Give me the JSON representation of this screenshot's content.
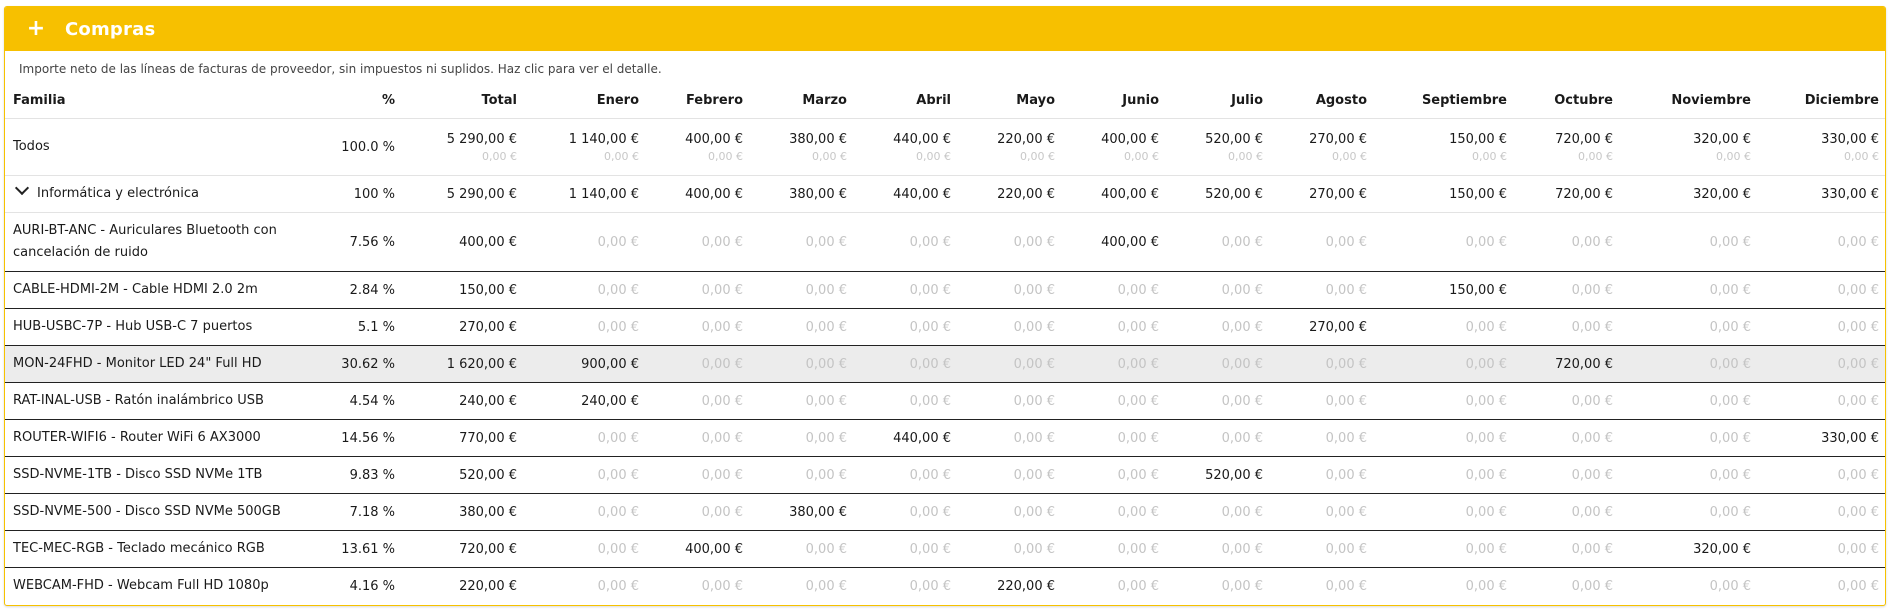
{
  "panel": {
    "title": "Compras",
    "expand_icon": "+",
    "description": "Importe neto de las líneas de facturas de proveedor, sin impuestos ni suplidos. Haz clic para ver el detalle.",
    "accent_color": "#f7c000"
  },
  "columns": {
    "familia": "Familia",
    "pct": "%",
    "total": "Total",
    "months": [
      "Enero",
      "Febrero",
      "Marzo",
      "Abril",
      "Mayo",
      "Junio",
      "Julio",
      "Agosto",
      "Septiembre",
      "Octubre",
      "Noviembre",
      "Diciembre"
    ]
  },
  "total_row": {
    "label": "Todos",
    "pct": "100.0 %",
    "total": "5 290,00 €",
    "total_sub": "0,00 €",
    "months": [
      "1 140,00 €",
      "400,00 €",
      "380,00 €",
      "440,00 €",
      "220,00 €",
      "400,00 €",
      "520,00 €",
      "270,00 €",
      "150,00 €",
      "720,00 €",
      "320,00 €",
      "330,00 €"
    ],
    "months_sub": [
      "0,00 €",
      "0,00 €",
      "0,00 €",
      "0,00 €",
      "0,00 €",
      "0,00 €",
      "0,00 €",
      "0,00 €",
      "0,00 €",
      "0,00 €",
      "0,00 €",
      "0,00 €"
    ]
  },
  "group_row": {
    "label": "Informática y electrónica",
    "icon": "chevron-down-icon",
    "pct": "100 %",
    "total": "5 290,00 €",
    "months": [
      "1 140,00 €",
      "400,00 €",
      "380,00 €",
      "440,00 €",
      "220,00 €",
      "400,00 €",
      "520,00 €",
      "270,00 €",
      "150,00 €",
      "720,00 €",
      "320,00 €",
      "330,00 €"
    ]
  },
  "items": [
    {
      "label": "AURI-BT-ANC - Auriculares Bluetooth con cancelación de ruido",
      "pct": "7.56 %",
      "total": "400,00 €",
      "months": [
        "0,00 €",
        "0,00 €",
        "0,00 €",
        "0,00 €",
        "0,00 €",
        "400,00 €",
        "0,00 €",
        "0,00 €",
        "0,00 €",
        "0,00 €",
        "0,00 €",
        "0,00 €"
      ]
    },
    {
      "label": "CABLE-HDMI-2M - Cable HDMI 2.0 2m",
      "pct": "2.84 %",
      "total": "150,00 €",
      "months": [
        "0,00 €",
        "0,00 €",
        "0,00 €",
        "0,00 €",
        "0,00 €",
        "0,00 €",
        "0,00 €",
        "0,00 €",
        "150,00 €",
        "0,00 €",
        "0,00 €",
        "0,00 €"
      ]
    },
    {
      "label": "HUB-USBC-7P - Hub USB-C 7 puertos",
      "pct": "5.1 %",
      "total": "270,00 €",
      "months": [
        "0,00 €",
        "0,00 €",
        "0,00 €",
        "0,00 €",
        "0,00 €",
        "0,00 €",
        "0,00 €",
        "270,00 €",
        "0,00 €",
        "0,00 €",
        "0,00 €",
        "0,00 €"
      ]
    },
    {
      "label": "MON-24FHD - Monitor LED 24\" Full HD",
      "pct": "30.62 %",
      "total": "1 620,00 €",
      "months": [
        "900,00 €",
        "0,00 €",
        "0,00 €",
        "0,00 €",
        "0,00 €",
        "0,00 €",
        "0,00 €",
        "0,00 €",
        "0,00 €",
        "720,00 €",
        "0,00 €",
        "0,00 €"
      ]
    },
    {
      "label": "RAT-INAL-USB - Ratón inalámbrico USB",
      "pct": "4.54 %",
      "total": "240,00 €",
      "months": [
        "240,00 €",
        "0,00 €",
        "0,00 €",
        "0,00 €",
        "0,00 €",
        "0,00 €",
        "0,00 €",
        "0,00 €",
        "0,00 €",
        "0,00 €",
        "0,00 €",
        "0,00 €"
      ]
    },
    {
      "label": "ROUTER-WIFI6 - Router WiFi 6 AX3000",
      "pct": "14.56 %",
      "total": "770,00 €",
      "months": [
        "0,00 €",
        "0,00 €",
        "0,00 €",
        "440,00 €",
        "0,00 €",
        "0,00 €",
        "0,00 €",
        "0,00 €",
        "0,00 €",
        "0,00 €",
        "0,00 €",
        "330,00 €"
      ]
    },
    {
      "label": "SSD-NVME-1TB - Disco SSD NVMe 1TB",
      "pct": "9.83 %",
      "total": "520,00 €",
      "months": [
        "0,00 €",
        "0,00 €",
        "0,00 €",
        "0,00 €",
        "0,00 €",
        "0,00 €",
        "520,00 €",
        "0,00 €",
        "0,00 €",
        "0,00 €",
        "0,00 €",
        "0,00 €"
      ]
    },
    {
      "label": "SSD-NVME-500 - Disco SSD NVMe 500GB",
      "pct": "7.18 %",
      "total": "380,00 €",
      "months": [
        "0,00 €",
        "0,00 €",
        "380,00 €",
        "0,00 €",
        "0,00 €",
        "0,00 €",
        "0,00 €",
        "0,00 €",
        "0,00 €",
        "0,00 €",
        "0,00 €",
        "0,00 €"
      ]
    },
    {
      "label": "TEC-MEC-RGB - Teclado mecánico RGB",
      "pct": "13.61 %",
      "total": "720,00 €",
      "months": [
        "0,00 €",
        "400,00 €",
        "0,00 €",
        "0,00 €",
        "0,00 €",
        "0,00 €",
        "0,00 €",
        "0,00 €",
        "0,00 €",
        "0,00 €",
        "320,00 €",
        "0,00 €"
      ]
    },
    {
      "label": "WEBCAM-FHD - Webcam Full HD 1080p",
      "pct": "4.16 %",
      "total": "220,00 €",
      "months": [
        "0,00 €",
        "0,00 €",
        "0,00 €",
        "0,00 €",
        "220,00 €",
        "0,00 €",
        "0,00 €",
        "0,00 €",
        "0,00 €",
        "0,00 €",
        "0,00 €",
        "0,00 €"
      ]
    }
  ],
  "highlighted_item": "MON-24FHD - Monitor LED 24\" Full HD"
}
